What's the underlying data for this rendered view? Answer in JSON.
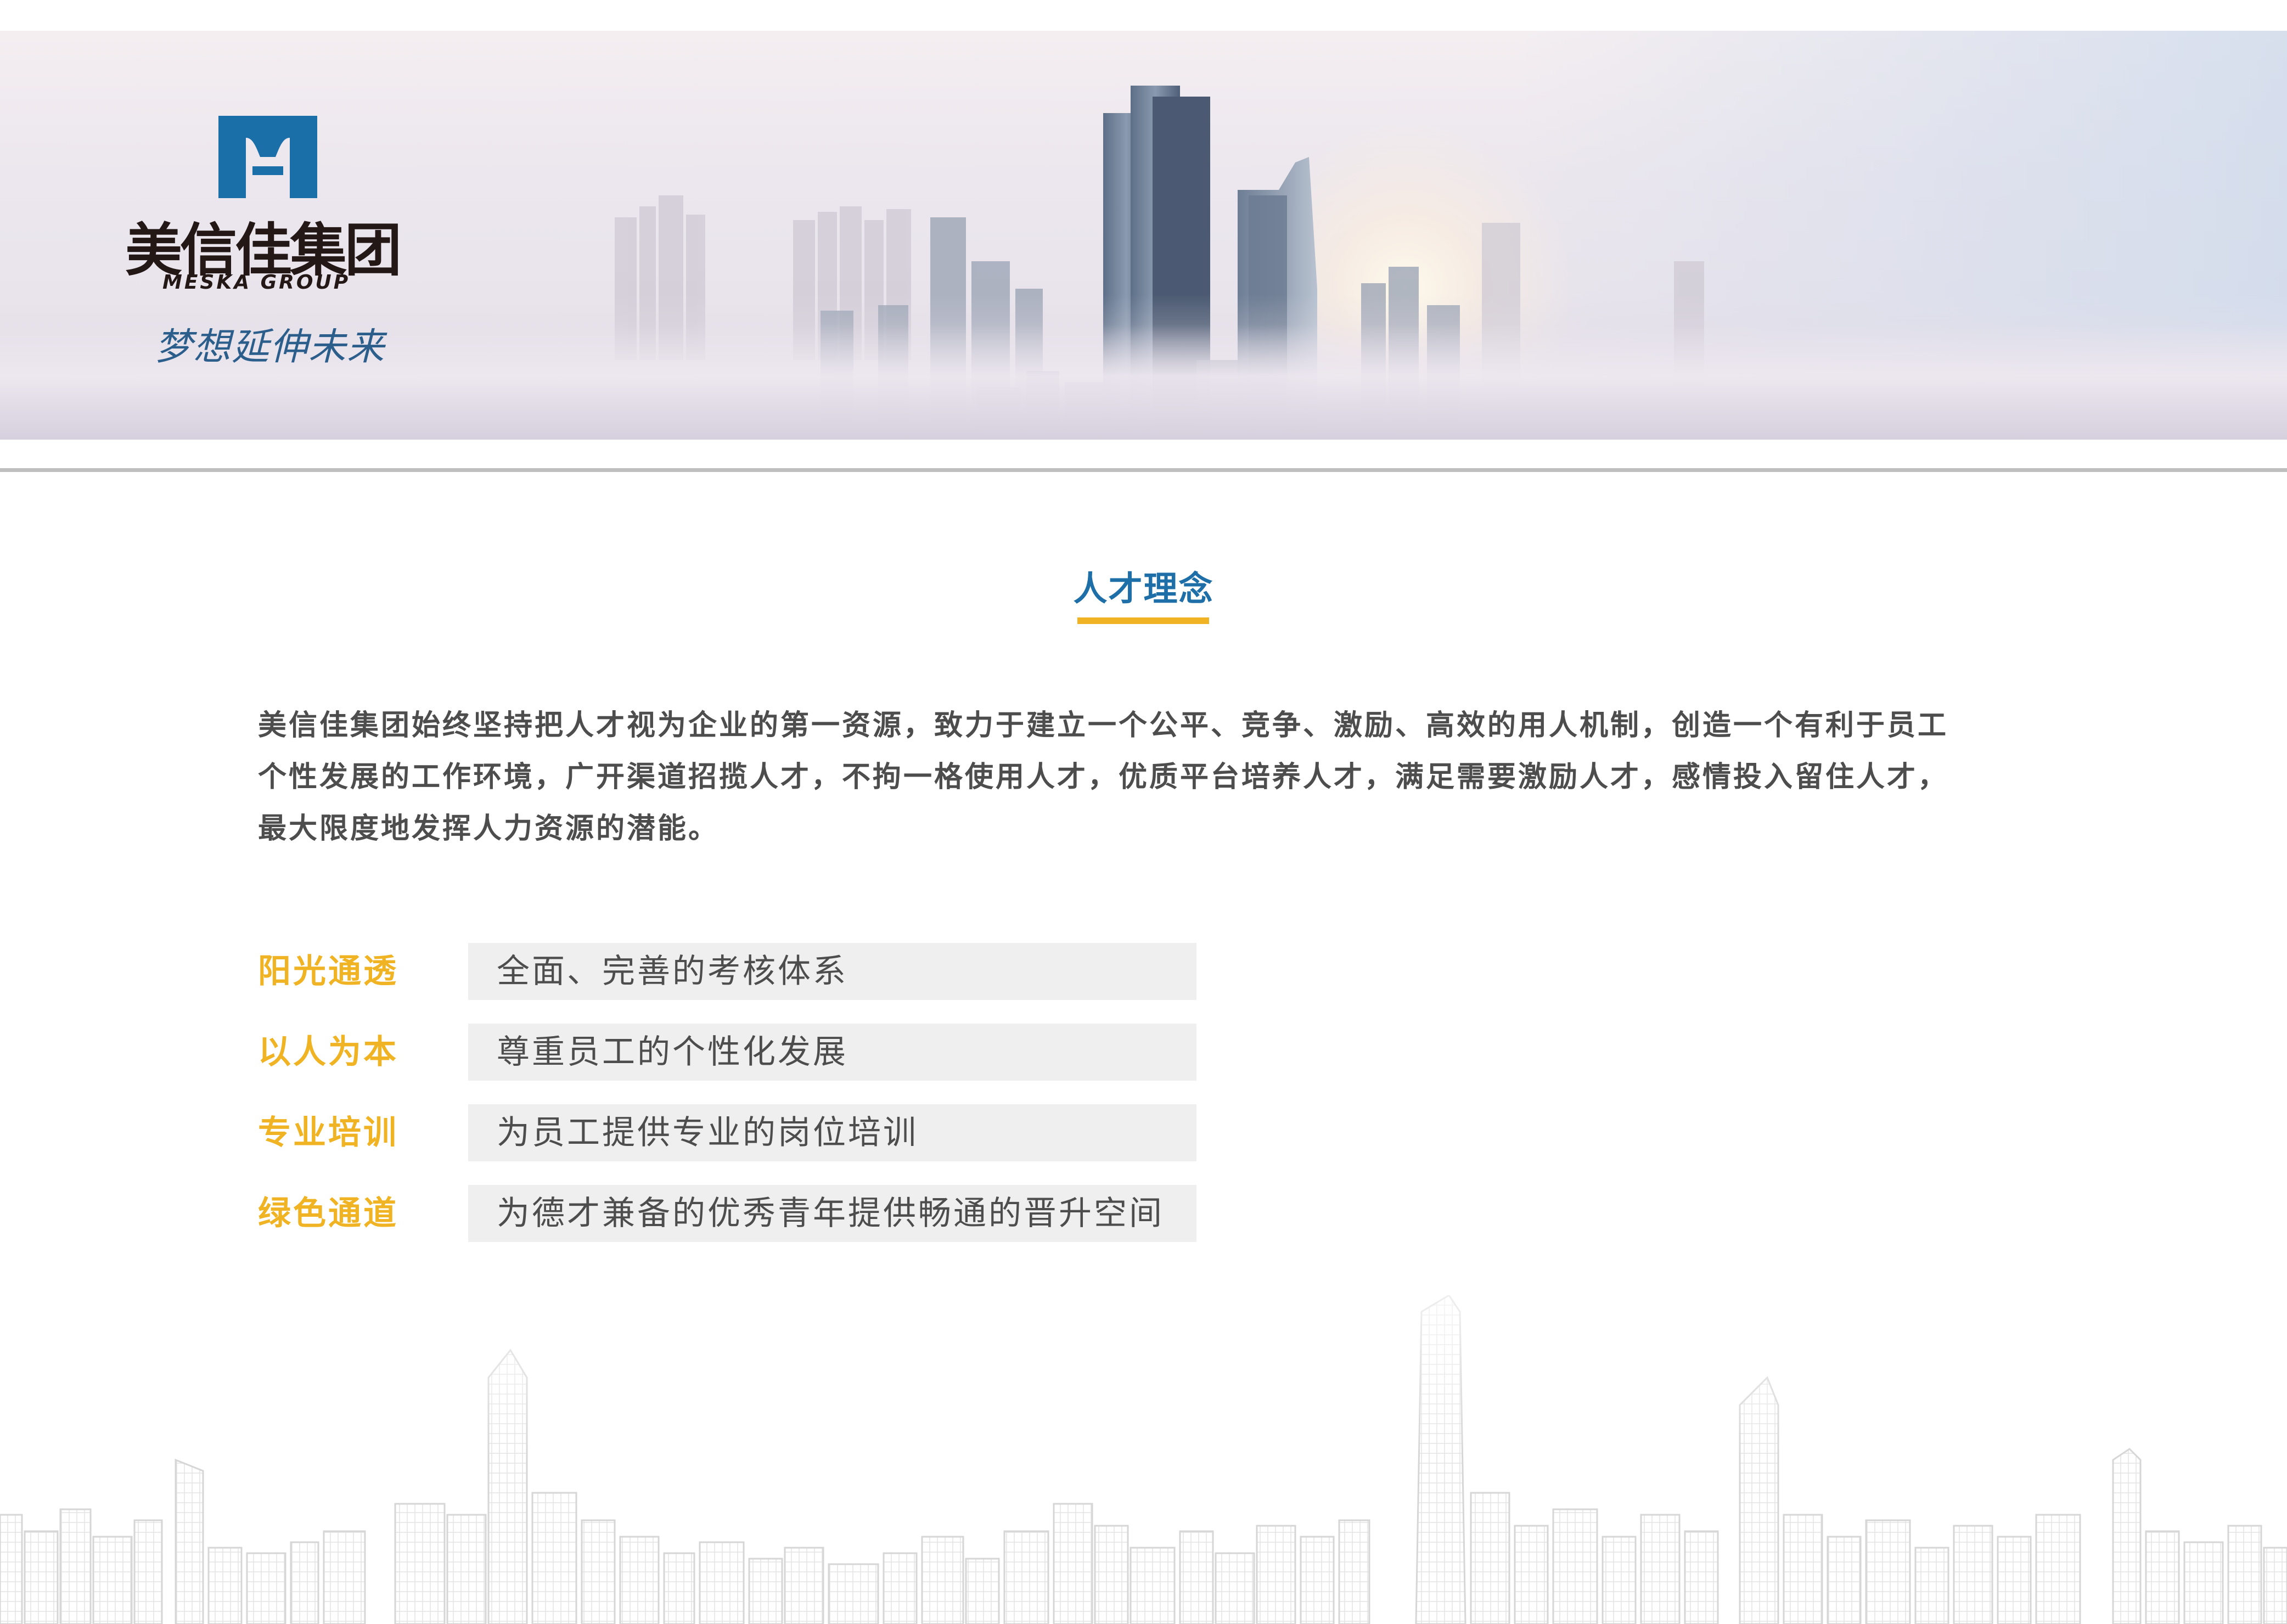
{
  "brand": {
    "name_cn": "美信佳集团",
    "name_en": "MESKA GROUP",
    "slogan": "梦想延伸未来"
  },
  "section": {
    "title": "人才理念"
  },
  "intro": {
    "lines": [
      "美信佳集团始终坚持把人才视为企业的第一资源，致力于建立一个公平、竞争、激励、高效的用人机制，创造一个有利于员工",
      "个性发展的工作环境，广开渠道招揽人才，不拘一格使用人才，优质平台培养人才，满足需要激励人才，感情投入留住人才，",
      "最大限度地发挥人力资源的潜能。"
    ]
  },
  "values": [
    {
      "label": "阳光通透",
      "text": "全面、完善的考核体系"
    },
    {
      "label": "以人为本",
      "text": "尊重员工的个性化发展"
    },
    {
      "label": "专业培训",
      "text": "为员工提供专业的岗位培训"
    },
    {
      "label": "绿色通道",
      "text": "为德才兼备的优秀青年提供畅通的晋升空间"
    }
  ],
  "colors": {
    "accent": "#f0b323",
    "title_blue": "#1e6fa8",
    "logo_blue": "#1b6fa8",
    "text_gray": "#4d4d4d",
    "value_box": "#efefef",
    "rule_gray": "#bfbfbf"
  },
  "icons": {
    "logo": "meska-m-logo-icon",
    "banner": "city-skyline-image",
    "footer": "city-skyline-line-art"
  }
}
